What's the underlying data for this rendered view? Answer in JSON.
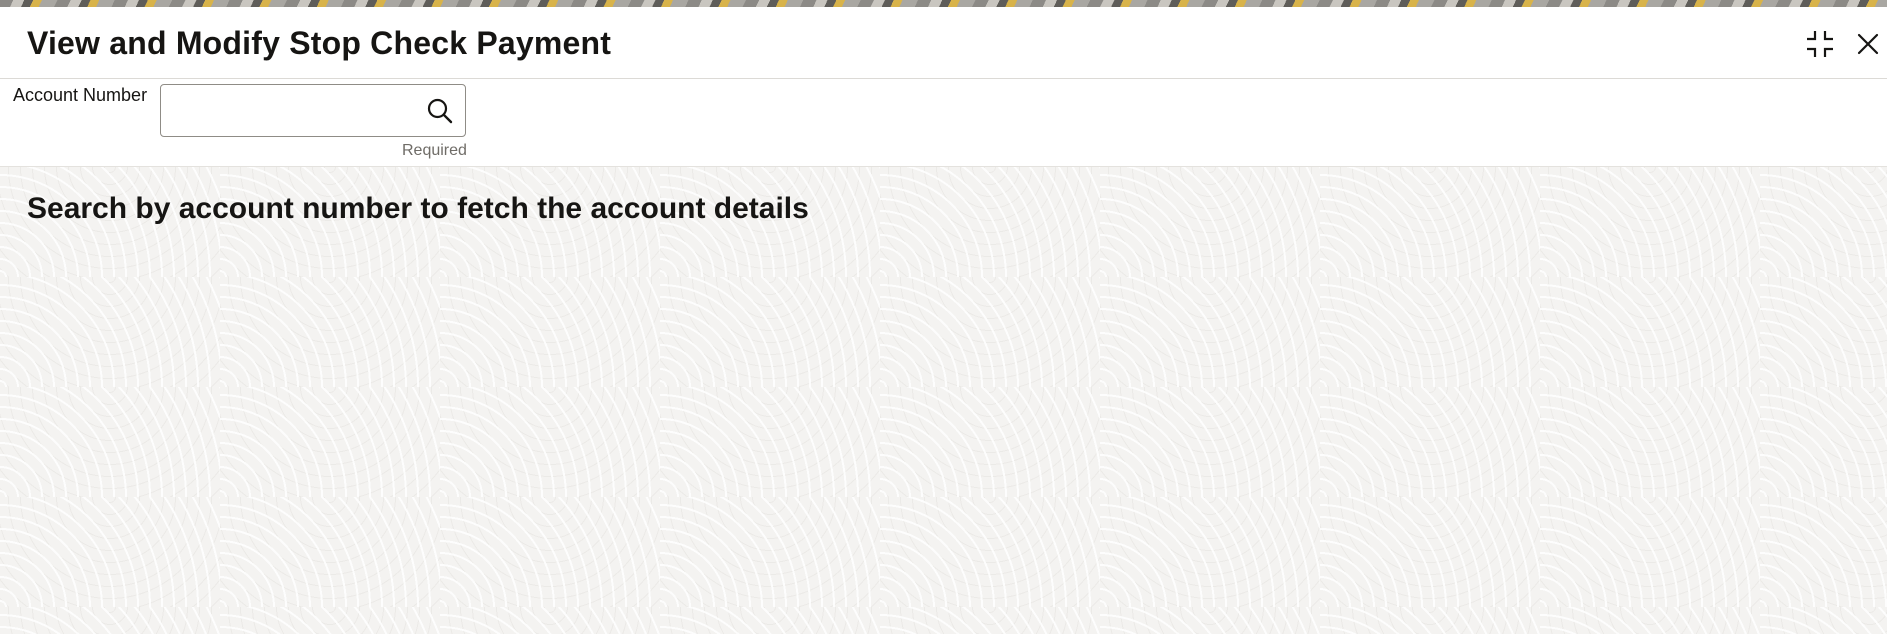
{
  "header": {
    "title": "View and Modify Stop Check Payment",
    "collapse_icon": "collapse-icon",
    "close_icon": "close-icon"
  },
  "form": {
    "account_number_label": "Account Number",
    "account_number_value": "",
    "account_number_placeholder": "",
    "search_icon": "search-icon",
    "required_hint": "Required"
  },
  "main": {
    "empty_message": "Search by account number to fetch the account details"
  }
}
